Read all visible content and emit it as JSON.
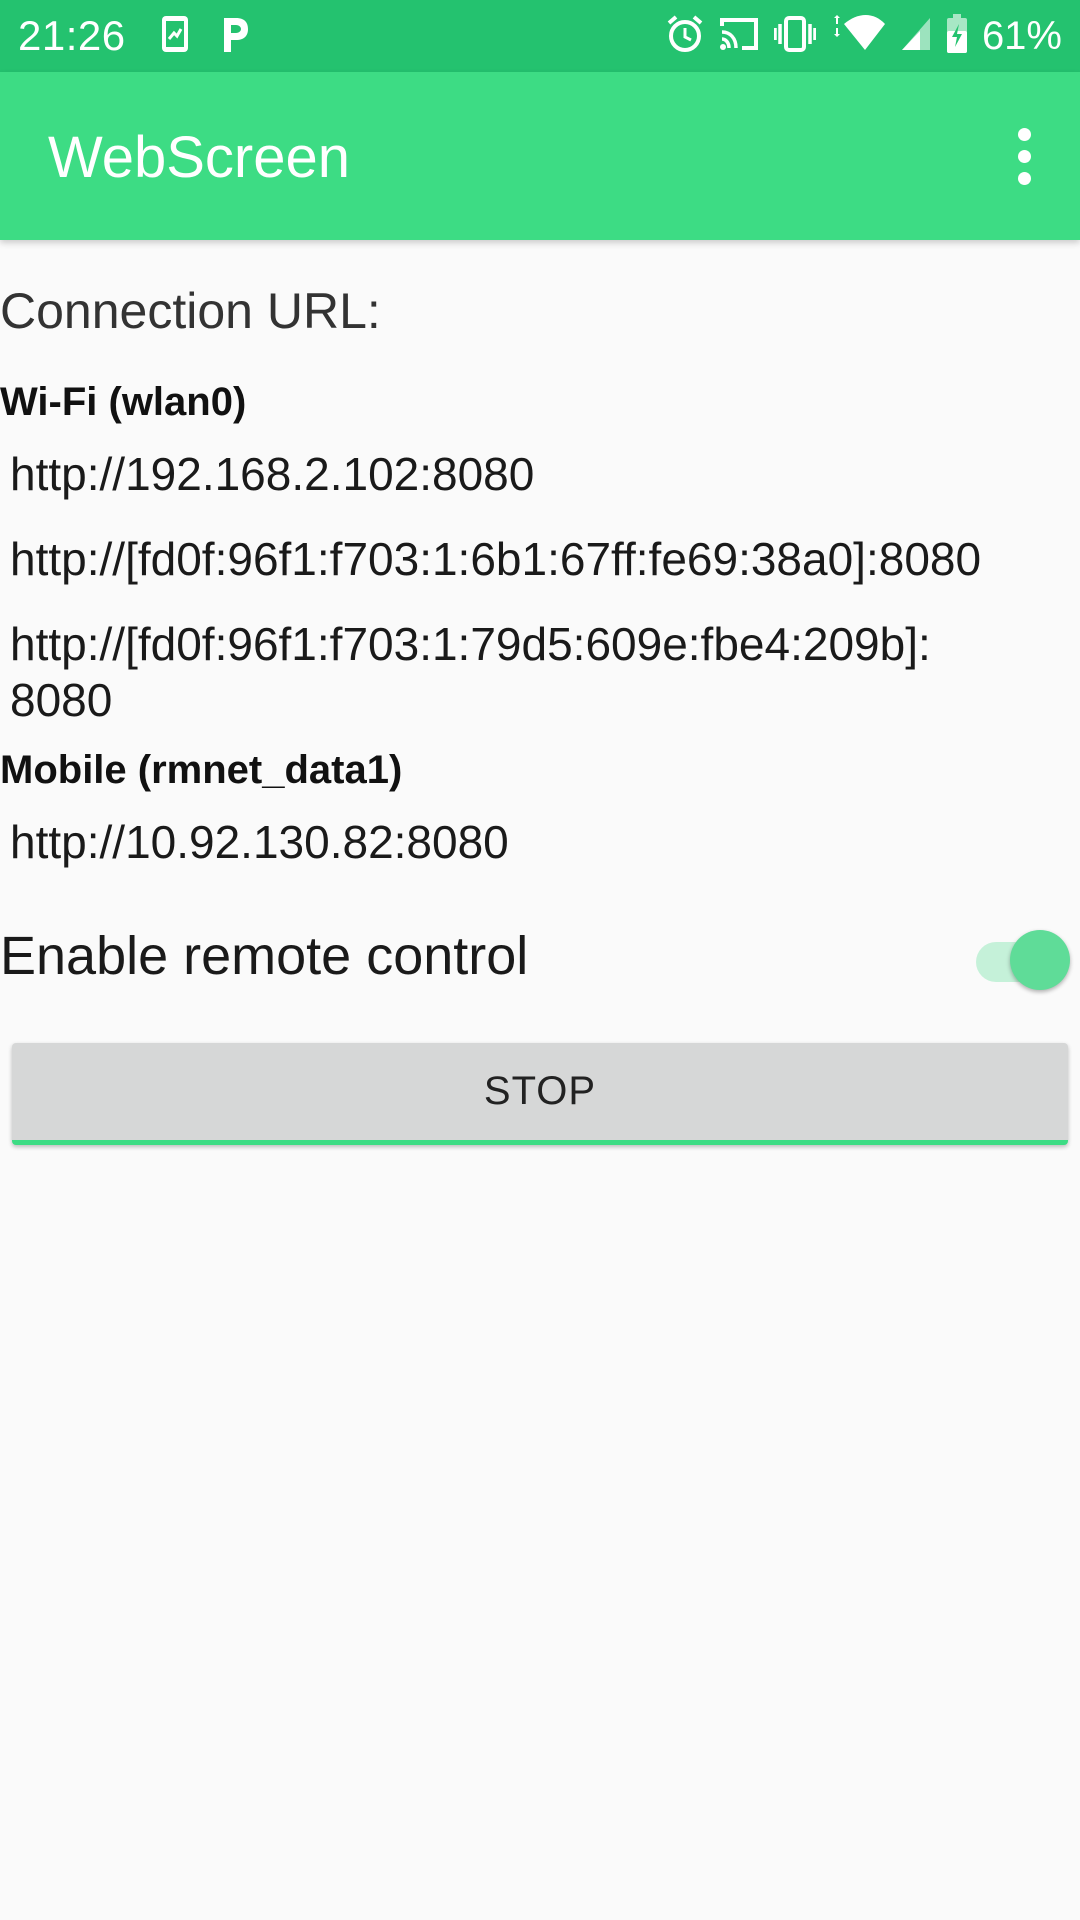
{
  "status_bar": {
    "time": "21:26",
    "battery_percent": "61%",
    "left_icons": [
      "screenshot-notification-icon",
      "parking-p-icon"
    ],
    "right_icons": [
      "alarm-icon",
      "cast-icon",
      "vibrate-icon",
      "wifi-icon",
      "cell-signal-icon",
      "battery-charging-icon"
    ],
    "background_color": "#24c26f"
  },
  "app_bar": {
    "title": "WebScreen",
    "background_color": "#3ddc84",
    "menu_icon": "more-vert-icon"
  },
  "main": {
    "heading": "Connection URL:",
    "sections": [
      {
        "label": "Wi-Fi (wlan0)",
        "urls": [
          "http://192.168.2.102:8080",
          "http://[fd0f:96f1:f703:1:6b1:67ff:fe69:38a0]:8080",
          "http://[fd0f:96f1:f703:1:79d5:609e:fbe4:209b]:\n8080"
        ]
      },
      {
        "label": "Mobile (rmnet_data1)",
        "urls": [
          "http://10.92.130.82:8080"
        ]
      }
    ],
    "remote_control": {
      "label": "Enable remote control",
      "enabled": true
    },
    "stop_button": "STOP"
  }
}
